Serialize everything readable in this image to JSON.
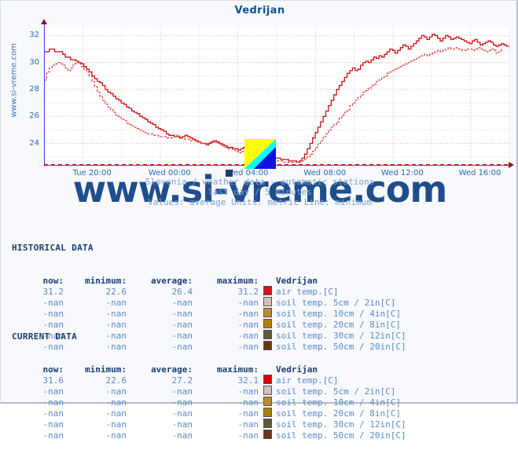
{
  "page": {
    "vertical_url": "www.si-vreme.com",
    "watermark": "www.si-vreme.com"
  },
  "chart": {
    "title": "Vedrijan",
    "subtitle_line1": "Slovenia / weather data - automatic stations",
    "subtitle_line2": "last day / 5 minutes",
    "subtitle_line3": "Values: average  Units: metric  Line: minimum"
  },
  "chart_data": {
    "type": "line",
    "title": "Vedrijan",
    "xlabel": "",
    "ylabel": "",
    "ylim": [
      22.4,
      32.6
    ],
    "yticks": [
      24,
      26,
      28,
      30,
      32
    ],
    "ytick_labels": [
      "24",
      "26",
      "28",
      "30",
      "32"
    ],
    "xtick_labels": [
      "Tue 20:00",
      "Wed 00:00",
      "Wed 04:00",
      "Wed 08:00",
      "Wed 12:00",
      "Wed 16:00"
    ],
    "grid": true,
    "legend": "none",
    "units": "metric",
    "series": [
      {
        "name": "air temp. [C] - average",
        "style": "solid",
        "color": "#cc1111",
        "values": [
          30.8,
          30.8,
          31.0,
          31.0,
          30.8,
          30.8,
          30.8,
          30.6,
          30.4,
          30.4,
          30.2,
          30.2,
          30.1,
          30.0,
          29.9,
          29.7,
          29.5,
          29.3,
          29.0,
          28.8,
          28.6,
          28.5,
          28.3,
          28.0,
          27.8,
          27.7,
          27.5,
          27.3,
          27.2,
          27.0,
          26.9,
          26.7,
          26.6,
          26.4,
          26.3,
          26.2,
          26.0,
          25.9,
          25.8,
          25.6,
          25.5,
          25.4,
          25.2,
          25.1,
          25.0,
          24.9,
          24.7,
          24.6,
          24.6,
          24.5,
          24.5,
          24.4,
          24.5,
          24.6,
          24.5,
          24.4,
          24.3,
          24.2,
          24.1,
          24.0,
          24.0,
          23.9,
          24.0,
          24.1,
          24.2,
          24.1,
          24.0,
          23.9,
          23.8,
          23.7,
          23.7,
          23.6,
          23.6,
          23.5,
          23.6,
          23.7,
          23.6,
          23.5,
          23.4,
          23.4,
          23.3,
          23.3,
          23.2,
          23.2,
          23.1,
          23.0,
          23.0,
          22.9,
          22.9,
          22.8,
          22.8,
          22.8,
          22.7,
          22.7,
          22.7,
          22.6,
          22.7,
          22.9,
          23.2,
          23.6,
          24.0,
          24.4,
          24.8,
          25.2,
          25.6,
          26.0,
          26.4,
          26.8,
          27.2,
          27.6,
          28.0,
          28.3,
          28.6,
          28.9,
          29.2,
          29.4,
          29.6,
          29.4,
          29.5,
          29.8,
          30.0,
          30.1,
          30.0,
          30.2,
          30.4,
          30.3,
          30.5,
          30.4,
          30.6,
          30.8,
          31.0,
          30.9,
          30.7,
          30.9,
          31.1,
          31.3,
          31.2,
          31.0,
          31.2,
          31.4,
          31.6,
          31.8,
          32.0,
          31.9,
          31.7,
          31.9,
          32.1,
          32.0,
          31.8,
          31.6,
          31.8,
          32.0,
          31.9,
          31.7,
          31.8,
          31.9,
          31.8,
          31.7,
          31.6,
          31.5,
          31.4,
          31.6,
          31.7,
          31.5,
          31.3,
          31.4,
          31.5,
          31.6,
          31.5,
          31.3,
          31.2,
          31.3,
          31.4,
          31.3,
          31.2,
          31.2
        ]
      },
      {
        "name": "air temp. [C] - minimum",
        "style": "dashed",
        "color": "#dd4444",
        "values": [
          28.7,
          29.3,
          29.6,
          29.8,
          29.9,
          30.0,
          29.9,
          29.8,
          29.6,
          29.4,
          29.6,
          29.9,
          30.0,
          29.9,
          29.7,
          29.5,
          29.3,
          29.0,
          28.6,
          28.2,
          27.8,
          27.5,
          27.2,
          26.9,
          26.7,
          26.5,
          26.3,
          26.1,
          26.0,
          25.8,
          25.7,
          25.5,
          25.4,
          25.3,
          25.2,
          25.1,
          25.0,
          24.9,
          24.8,
          24.7,
          24.7,
          24.6,
          24.6,
          24.5,
          24.5,
          24.5,
          24.4,
          24.4,
          24.4,
          24.5,
          24.6,
          24.5,
          24.4,
          24.3,
          24.3,
          24.2,
          24.2,
          24.1,
          24.1,
          24.0,
          24.0,
          24.0,
          24.1,
          24.2,
          24.1,
          24.0,
          23.9,
          23.8,
          23.7,
          23.6,
          23.6,
          23.5,
          23.4,
          23.3,
          23.4,
          23.5,
          23.4,
          23.3,
          23.2,
          23.1,
          23.1,
          23.0,
          23.0,
          22.9,
          22.9,
          22.8,
          22.8,
          22.7,
          22.7,
          22.7,
          22.6,
          22.6,
          22.6,
          22.6,
          22.6,
          22.6,
          22.6,
          22.7,
          22.8,
          23.0,
          23.2,
          23.4,
          23.7,
          24.0,
          24.2,
          24.5,
          24.7,
          25.0,
          25.2,
          25.4,
          25.6,
          25.9,
          26.1,
          26.3,
          26.5,
          26.8,
          27.0,
          27.2,
          27.4,
          27.6,
          27.8,
          27.9,
          28.1,
          28.3,
          28.4,
          28.6,
          28.7,
          28.9,
          29.0,
          29.2,
          29.3,
          29.4,
          29.5,
          29.6,
          29.7,
          29.8,
          29.9,
          30.0,
          30.1,
          30.2,
          30.3,
          30.4,
          30.5,
          30.6,
          30.5,
          30.6,
          30.7,
          30.8,
          30.9,
          30.8,
          30.9,
          31.0,
          31.1,
          31.0,
          31.0,
          31.1,
          31.0,
          30.9,
          30.9,
          31.0,
          31.0,
          30.9,
          31.0,
          31.1,
          31.0,
          30.9,
          30.8,
          30.9,
          31.0,
          30.9,
          30.7,
          30.8,
          31.1
        ]
      }
    ]
  },
  "historical": {
    "section_title": "HISTORICAL DATA",
    "headers": {
      "now": "now:",
      "minimum": "minimum:",
      "average": "average:",
      "maximum": "maximum:",
      "station": "Vedrijan"
    },
    "rows": [
      {
        "now": "31.2",
        "minimum": "22.6",
        "average": "26.4",
        "maximum": "31.2",
        "color": "#d61111",
        "label": "air temp.[C]"
      },
      {
        "now": "-nan",
        "minimum": "-nan",
        "average": "-nan",
        "maximum": "-nan",
        "color": "#d9bdb8",
        "label": "soil temp. 5cm / 2in[C]"
      },
      {
        "now": "-nan",
        "minimum": "-nan",
        "average": "-nan",
        "maximum": "-nan",
        "color": "#c08a33",
        "label": "soil temp. 10cm / 4in[C]"
      },
      {
        "now": "-nan",
        "minimum": "-nan",
        "average": "-nan",
        "maximum": "-nan",
        "color": "#b77f08",
        "label": "soil temp. 20cm / 8in[C]"
      },
      {
        "now": "-nan",
        "minimum": "-nan",
        "average": "-nan",
        "maximum": "-nan",
        "color": "#5f5a3a",
        "label": "soil temp. 30cm / 12in[C]"
      },
      {
        "now": "-nan",
        "minimum": "-nan",
        "average": "-nan",
        "maximum": "-nan",
        "color": "#6b3410",
        "label": "soil temp. 50cm / 20in[C]"
      }
    ]
  },
  "current": {
    "section_title": "CURRENT DATA",
    "headers": {
      "now": "now:",
      "minimum": "minimum:",
      "average": "average:",
      "maximum": "maximum:",
      "station": "Vedrijan"
    },
    "rows": [
      {
        "now": "31.6",
        "minimum": "22.6",
        "average": "27.2",
        "maximum": "32.1",
        "color": "#d80000",
        "label": "air temp.[C]"
      },
      {
        "now": "-nan",
        "minimum": "-nan",
        "average": "-nan",
        "maximum": "-nan",
        "color": "#d8bdb8",
        "label": "soil temp. 5cm / 2in[C]"
      },
      {
        "now": "-nan",
        "minimum": "-nan",
        "average": "-nan",
        "maximum": "-nan",
        "color": "#c08a33",
        "label": "soil temp. 10cm / 4in[C]"
      },
      {
        "now": "-nan",
        "minimum": "-nan",
        "average": "-nan",
        "maximum": "-nan",
        "color": "#b07e05",
        "label": "soil temp. 20cm / 8in[C]"
      },
      {
        "now": "-nan",
        "minimum": "-nan",
        "average": "-nan",
        "maximum": "-nan",
        "color": "#5f5a3a",
        "label": "soil temp. 30cm / 12in[C]"
      },
      {
        "now": "-nan",
        "minimum": "-nan",
        "average": "-nan",
        "maximum": "-nan",
        "color": "#6b3410",
        "label": "soil temp. 50cm / 20in[C]"
      }
    ]
  }
}
